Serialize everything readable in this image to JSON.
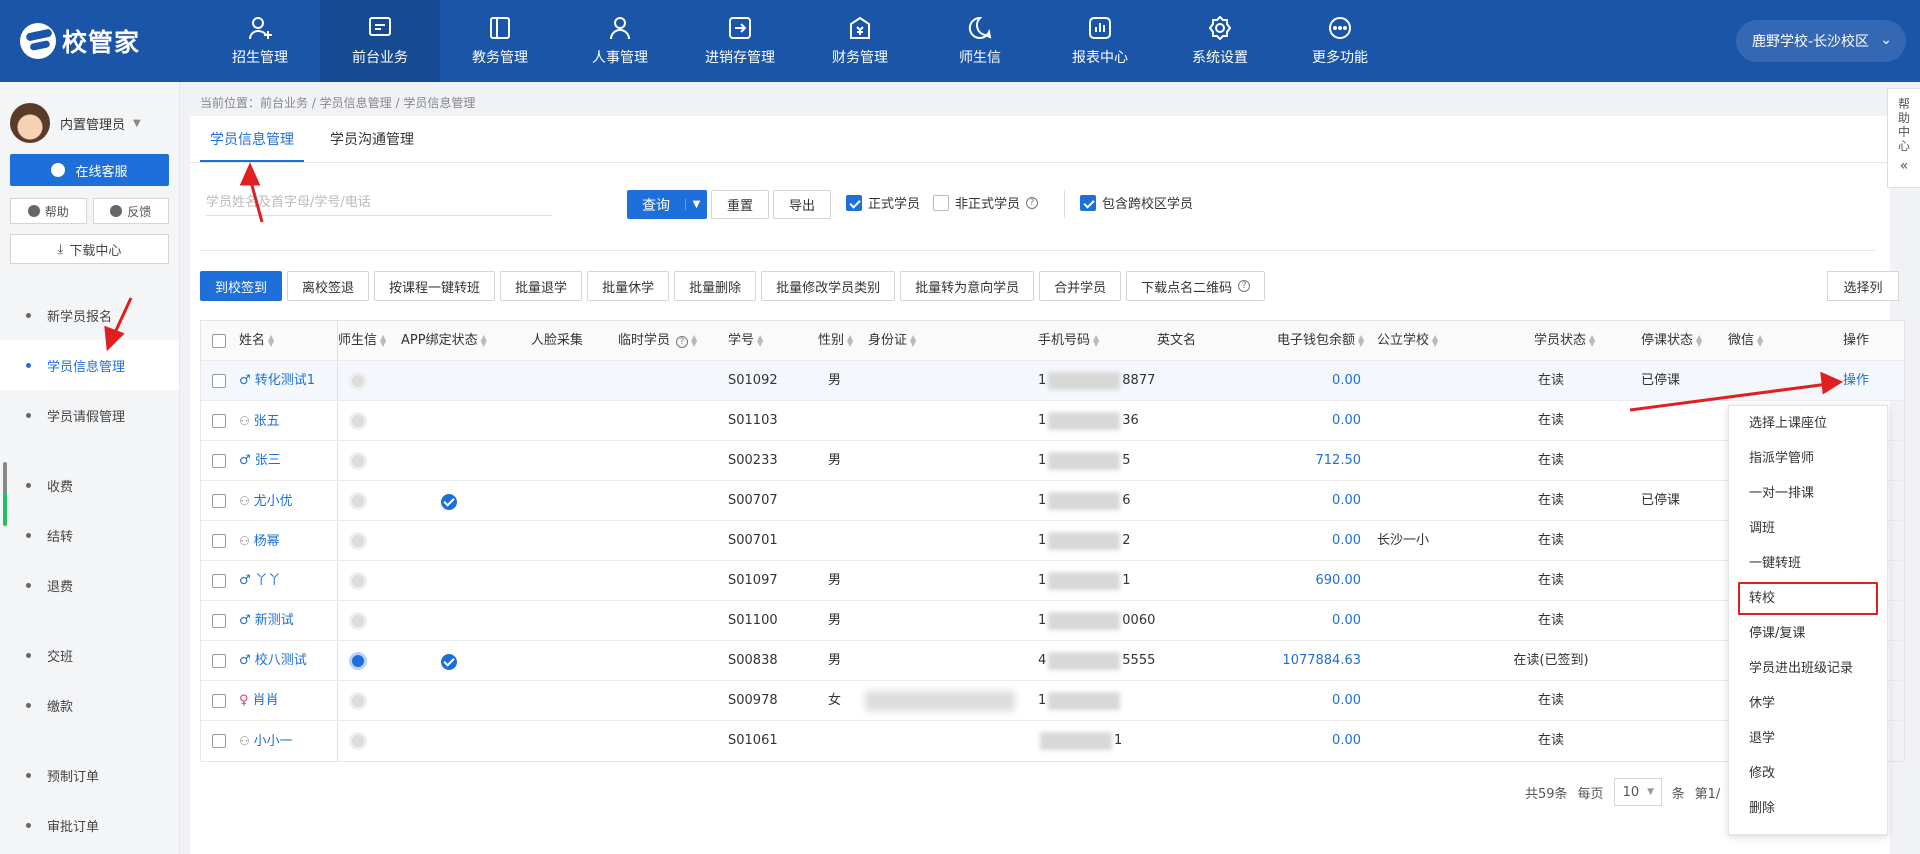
{
  "app": {
    "logo_text": "校管家"
  },
  "topnav": {
    "items": [
      {
        "label": "招生管理",
        "icon": "user-plus-icon"
      },
      {
        "label": "前台业务",
        "icon": "screen-icon"
      },
      {
        "label": "教务管理",
        "icon": "book-icon"
      },
      {
        "label": "人事管理",
        "icon": "person-icon"
      },
      {
        "label": "进销存管理",
        "icon": "transfer-icon"
      },
      {
        "label": "财务管理",
        "icon": "money-icon"
      },
      {
        "label": "师生信",
        "icon": "chat-icon"
      },
      {
        "label": "报表中心",
        "icon": "report-icon"
      },
      {
        "label": "系统设置",
        "icon": "gear-icon"
      },
      {
        "label": "更多功能",
        "icon": "more-icon"
      }
    ],
    "active_index": 1,
    "school": "鹿野学校-长沙校区"
  },
  "sidebar": {
    "user_name": "内置管理员",
    "service_label": "在线客服",
    "help_label": "帮助",
    "feedback_label": "反馈",
    "download_label": "下载中心",
    "items": [
      {
        "label": "新学员报名"
      },
      {
        "label": "学员信息管理"
      },
      {
        "label": "学员请假管理"
      },
      {
        "label": "收费"
      },
      {
        "label": "结转"
      },
      {
        "label": "退费"
      },
      {
        "label": "交班"
      },
      {
        "label": "缴款"
      },
      {
        "label": "预制订单"
      },
      {
        "label": "审批订单"
      }
    ]
  },
  "breadcrumb": "当前位置：前台业务 / 学员信息管理 / 学员信息管理",
  "tabs": [
    "学员信息管理",
    "学员沟通管理"
  ],
  "search": {
    "placeholder": "学员姓名及首字母/学号/电话"
  },
  "filters": {
    "query": "查询",
    "reset": "重置",
    "export": "导出",
    "formal": "正式学员",
    "informal": "非正式学员",
    "cross_campus": "包含跨校区学员"
  },
  "actions": [
    "到校签到",
    "离校签退",
    "按课程一键转班",
    "批量退学",
    "批量休学",
    "批量删除",
    "批量修改学员类别",
    "批量转为意向学员",
    "合并学员",
    "下载点名二维码"
  ],
  "select_columns": "选择列",
  "table": {
    "headers": {
      "name": "姓名",
      "sst": "师生信",
      "app": "APP绑定状态",
      "face": "人脸采集",
      "temp": "临时学员",
      "no": "学号",
      "sex": "性别",
      "idcard": "身份证",
      "phone": "手机号码",
      "en": "英文名",
      "wallet": "电子钱包余额",
      "school": "公立学校",
      "status": "学员状态",
      "stop": "停课状态",
      "wechat": "微信",
      "op": "操作"
    },
    "rows": [
      {
        "name": "转化测试1",
        "sexicon": "male",
        "no": "S01092",
        "sex": "男",
        "phone_a": "1",
        "phone_b": "8877",
        "wallet": "0.00",
        "school": "",
        "status": "在读",
        "stop": "已停课",
        "app": false,
        "op": "操作"
      },
      {
        "name": "张五",
        "sexicon": "none",
        "no": "S01103",
        "sex": "",
        "phone_a": "1",
        "phone_b": "36",
        "wallet": "0.00",
        "school": "",
        "status": "在读",
        "stop": "",
        "app": false
      },
      {
        "name": "张三",
        "sexicon": "male",
        "no": "S00233",
        "sex": "男",
        "phone_a": "1",
        "phone_b": "5",
        "wallet": "712.50",
        "school": "",
        "status": "在读",
        "stop": "",
        "app": false
      },
      {
        "name": "尤小优",
        "sexicon": "none",
        "no": "S00707",
        "sex": "",
        "phone_a": "1",
        "phone_b": "6",
        "wallet": "0.00",
        "school": "",
        "status": "在读",
        "stop": "已停课",
        "app": true
      },
      {
        "name": "杨幂",
        "sexicon": "none",
        "no": "S00701",
        "sex": "",
        "phone_a": "1",
        "phone_b": "2",
        "wallet": "0.00",
        "school": "长沙一小",
        "status": "在读",
        "stop": "",
        "app": false
      },
      {
        "name": "丫丫",
        "sexicon": "male",
        "no": "S01097",
        "sex": "男",
        "phone_a": "1",
        "phone_b": "1",
        "wallet": "690.00",
        "school": "",
        "status": "在读",
        "stop": "",
        "app": false
      },
      {
        "name": "新测试",
        "sexicon": "male",
        "no": "S01100",
        "sex": "男",
        "phone_a": "1",
        "phone_b": "0060",
        "wallet": "0.00",
        "school": "",
        "status": "在读",
        "stop": "",
        "app": false
      },
      {
        "name": "校八测试",
        "sexicon": "male",
        "no": "S00838",
        "sex": "男",
        "phone_a": "4",
        "phone_b": "5555",
        "wallet": "1077884.63",
        "school": "",
        "status": "在读(已签到)",
        "stop": "",
        "app": true,
        "wx_blue": true
      },
      {
        "name": "肖肖",
        "sexicon": "female",
        "no": "S00978",
        "sex": "女",
        "phone_a": "1",
        "phone_b": "",
        "wallet": "0.00",
        "school": "",
        "status": "在读",
        "stop": "",
        "app": false,
        "idblur": true
      },
      {
        "name": "小小一",
        "sexicon": "none",
        "no": "S01061",
        "sex": "",
        "phone_a": "",
        "phone_b": "1",
        "wallet": "0.00",
        "school": "",
        "status": "在读",
        "stop": "",
        "app": false
      }
    ]
  },
  "pagination": {
    "total": "共59条",
    "per_page_label": "每页",
    "per_page": "10",
    "unit": "条",
    "page": "第1/"
  },
  "op_menu": [
    "选择上课座位",
    "指派学管师",
    "一对一排课",
    "调班",
    "一键转班",
    "转校",
    "停课/复课",
    "学员进出班级记录",
    "休学",
    "退学",
    "修改",
    "删除"
  ],
  "op_menu_highlight_index": 5,
  "help_tab": [
    "帮",
    "助",
    "中",
    "心"
  ],
  "colors": {
    "nav": "#1a55a8",
    "primary": "#1e6fd9",
    "annotation": "#e02020"
  }
}
